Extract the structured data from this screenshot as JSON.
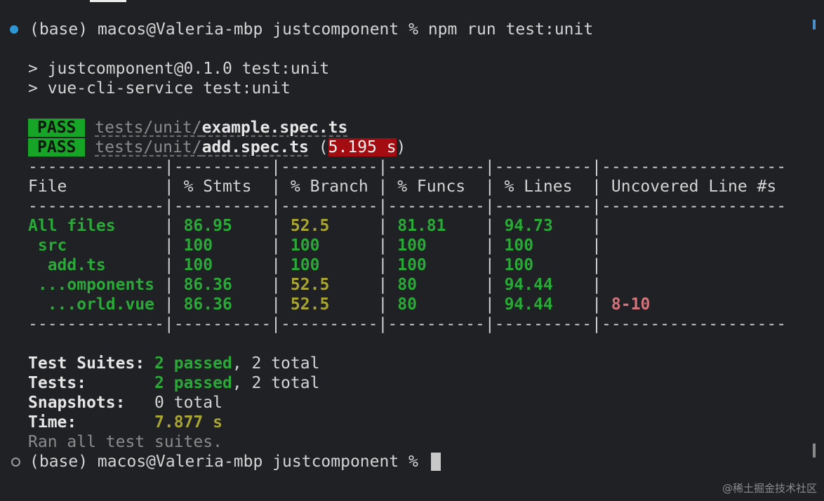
{
  "prompt1": {
    "env": "(base)",
    "userhost": "macos@Valeria-mbp",
    "dir": "justcomponent",
    "symbol": "%",
    "command": "npm run test:unit"
  },
  "script_lines": [
    "> justcomponent@0.1.0 test:unit",
    "> vue-cli-service test:unit"
  ],
  "results": [
    {
      "status": "PASS",
      "dir": "tests/unit/",
      "file": "example.spec.ts",
      "time": ""
    },
    {
      "status": "PASS",
      "dir": "tests/unit/",
      "file": "add.spec.ts",
      "time": "5.195 s"
    }
  ],
  "coverage": {
    "separator": "--------------|----------|----------|----------|----------|-------------------",
    "headers": [
      "File",
      "% Stmts",
      "% Branch",
      "% Funcs",
      "% Lines",
      "Uncovered Line #s"
    ],
    "rows": [
      {
        "file": "All files",
        "stmts": "86.95",
        "branch": "52.5",
        "funcs": "81.81",
        "lines": "94.73",
        "uncovered": ""
      },
      {
        "file": " src",
        "stmts": "100",
        "branch": "100",
        "funcs": "100",
        "lines": "100",
        "uncovered": ""
      },
      {
        "file": "  add.ts",
        "stmts": "100",
        "branch": "100",
        "funcs": "100",
        "lines": "100",
        "uncovered": ""
      },
      {
        "file": " ...omponents",
        "stmts": "86.36",
        "branch": "52.5",
        "funcs": "80",
        "lines": "94.44",
        "uncovered": ""
      },
      {
        "file": "  ...orld.vue",
        "stmts": "86.36",
        "branch": "52.5",
        "funcs": "80",
        "lines": "94.44",
        "uncovered": "8-10"
      }
    ]
  },
  "summary": {
    "suites_label": "Test Suites:",
    "suites_passed": "2 passed",
    "suites_total": ", 2 total",
    "tests_label": "Tests:",
    "tests_passed": "2 passed",
    "tests_total": ", 2 total",
    "snapshots_label": "Snapshots:",
    "snapshots_value": "0 total",
    "time_label": "Time:",
    "time_value": "7.877 s",
    "ran_all": "Ran all test suites."
  },
  "prompt2": {
    "text": "(base) macos@Valeria-mbp justcomponent %"
  },
  "watermark": "@稀土掘金技术社区",
  "colors": {
    "background": "#1f2124",
    "pass_badge": "#17a528",
    "slow_badge": "#a30d12",
    "good": "#2aa838",
    "medium": "#a8a535",
    "uncovered": "#d3737b"
  }
}
